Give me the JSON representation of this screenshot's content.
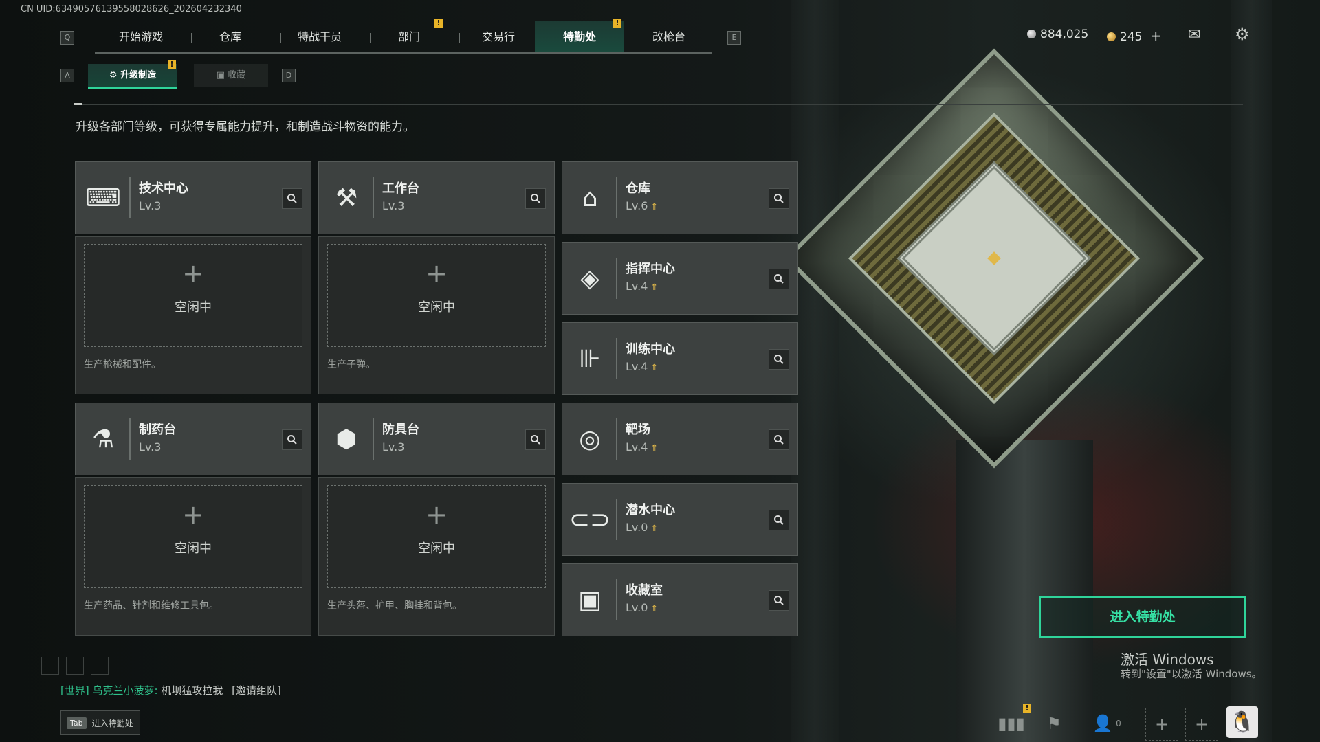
{
  "uid": "CN UID:634905761395580286​26_202604232340",
  "top_nav": {
    "left_key": "Q",
    "right_key": "E",
    "tabs": [
      {
        "label": "开始游戏"
      },
      {
        "label": "仓库"
      },
      {
        "label": "特战干员"
      },
      {
        "label": "部门"
      },
      {
        "label": "交易行"
      },
      {
        "label": "特勤处",
        "active": true
      },
      {
        "label": "改枪台"
      }
    ],
    "badge": "!"
  },
  "currency": {
    "silver": "884,025",
    "gold": "245",
    "plus": "+"
  },
  "sub_tabs": {
    "left_key": "A",
    "right_key": "D",
    "upgrade": "升级制造",
    "collection": "收藏"
  },
  "description": "升级各部门等级，可获得专属能力提升，和制造战斗物资的能力。",
  "production": [
    {
      "name": "技术中心",
      "level": "Lv.3",
      "idle": "空闲中",
      "note": "生产枪械和配件。"
    },
    {
      "name": "工作台",
      "level": "Lv.3",
      "idle": "空闲中",
      "note": "生产子弹。"
    },
    {
      "name": "制药台",
      "level": "Lv.3",
      "idle": "空闲中",
      "note": "生产药品、针剂和维修工具包。"
    },
    {
      "name": "防具台",
      "level": "Lv.3",
      "idle": "空闲中",
      "note": "生产头盔、护甲、胸挂和背包。"
    }
  ],
  "facilities": [
    {
      "name": "仓库",
      "level": "Lv.6"
    },
    {
      "name": "指挥中心",
      "level": "Lv.4"
    },
    {
      "name": "训练中心",
      "level": "Lv.4"
    },
    {
      "name": "靶场",
      "level": "Lv.4"
    },
    {
      "name": "潜水中心",
      "level": "Lv.0"
    },
    {
      "name": "收藏室",
      "level": "Lv.0"
    }
  ],
  "enter_button": "进入特勤处",
  "activate": {
    "line1": "激活 Windows",
    "line2": "转到\"设置\"以激活 Windows。"
  },
  "chat": {
    "channel": "[世界]",
    "sender": "乌克兰小菠萝:",
    "message": "机坝猛攻拉我",
    "link": "[邀请组队]"
  },
  "tab_hint": {
    "key": "Tab",
    "text": "进入特勤处"
  },
  "friends_count": "0",
  "colors": {
    "accent": "#2fd49a",
    "badge": "#e8b428",
    "card_bg": "#3d4140"
  }
}
